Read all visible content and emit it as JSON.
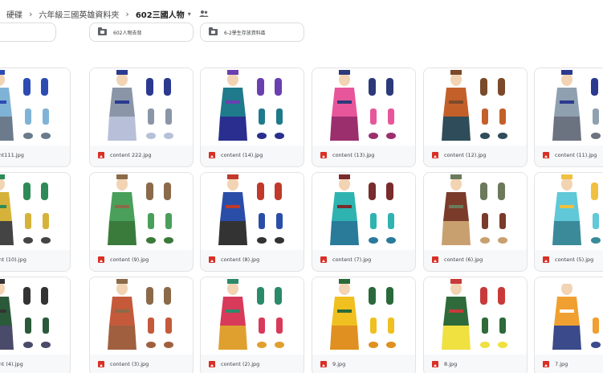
{
  "breadcrumb": {
    "items": [
      "硬碟",
      "六年級三國英雄資料夾",
      "602三國人物"
    ],
    "separator": "›",
    "caret": "▾"
  },
  "folders": [
    {
      "name": ""
    },
    {
      "name": "602人物去背"
    },
    {
      "name": "6-2學生存放資料區"
    }
  ],
  "files": [
    "ontent111.jpg",
    "content 222.jpg",
    "content (14).jpg",
    "content (13).jpg",
    "content (12).jpg",
    "content (11).jpg",
    "ontent (10).jpg",
    "content (9).jpg",
    "content (8).jpg",
    "content (7).jpg",
    "content (6).jpg",
    "content (5).jpg",
    "ontent (4).jpg",
    "content (3).jpg",
    "content (2).jpg",
    "9.jpg",
    "8.jpg",
    "7.jpg"
  ],
  "colors": {
    "image_icon": "#d93025",
    "card_border": "#e3e3e3",
    "thumb_palettes": [
      [
        "#7fb3d5",
        "#2d4bb3",
        "#6b7b8c"
      ],
      [
        "#8a96a8",
        "#2b3a8f",
        "#b7c0d8"
      ],
      [
        "#1f7a8c",
        "#6a3fb0",
        "#2a2f8f"
      ],
      [
        "#e7569a",
        "#2c3a7a",
        "#9b2f6e"
      ],
      [
        "#c3602a",
        "#7b4a2a",
        "#2f4c5a"
      ],
      [
        "#8fa0b0",
        "#2b3a8f",
        "#6b7280"
      ],
      [
        "#d5b33a",
        "#2e8b57",
        "#444"
      ],
      [
        "#4aa05a",
        "#8b6a4a",
        "#3a7a3a"
      ],
      [
        "#2a4ea8",
        "#c0392b",
        "#333"
      ],
      [
        "#2fb3b0",
        "#7a2b2b",
        "#2a7a9a"
      ],
      [
        "#7a3b2b",
        "#6b7a5a",
        "#c8a070"
      ],
      [
        "#60c8d8",
        "#f0c040",
        "#3a8a9a"
      ],
      [
        "#2b5a3a",
        "#333333",
        "#4a4a6a"
      ],
      [
        "#c45a3a",
        "#8b6a4a",
        "#a06040"
      ],
      [
        "#d83a5a",
        "#2b8a6a",
        "#e0a030"
      ],
      [
        "#f0c020",
        "#2a6a3a",
        "#e09020"
      ],
      [
        "#2f6a3a",
        "#c83a3a",
        "#f0e040"
      ],
      [
        "#f0a030",
        "#ffffff",
        "#3a4a8a"
      ]
    ]
  }
}
